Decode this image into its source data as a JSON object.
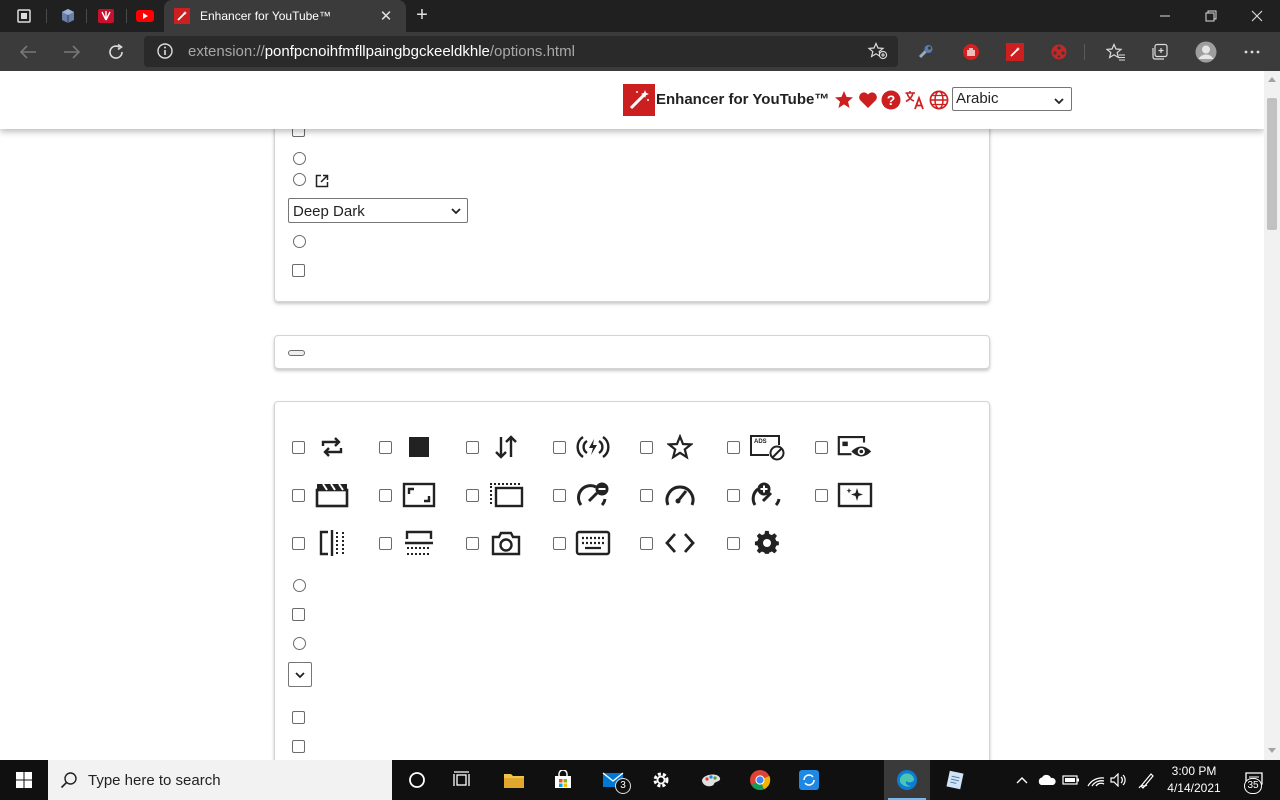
{
  "browser": {
    "active_tab_title": "Enhancer for YouTube™",
    "tab_close": "✕",
    "new_tab": "+",
    "url": {
      "scheme": "extension://",
      "host": "ponfpcnoihfmfllpaingbgckeeldkhle",
      "path": "/options.html"
    },
    "pinned_tabs": [
      "tab-actions-icon",
      "vm-app-icon",
      "huawei-icon",
      "youtube-icon"
    ],
    "toolbar_icons": [
      "star-add-icon",
      "extension-wrench-icon",
      "hand-stop-icon",
      "enhancer-icon",
      "film-reel-icon",
      "favorites-icon",
      "collections-icon",
      "profile-avatar",
      "more-icon"
    ]
  },
  "header": {
    "title": "Enhancer for YouTube™",
    "language_value": "Arabic",
    "icons": [
      "rate-star-icon",
      "donate-heart-icon",
      "help-icon",
      "translate-icon",
      "language-globe-icon"
    ],
    "accent": "#cc1f1f"
  },
  "theme_select": {
    "value": "Deep Dark"
  },
  "controls_buttons": {
    "rows": [
      [
        "loop-icon",
        "stop-icon",
        "sort-icon",
        "live-icon",
        "star-icon",
        "ads-block-icon",
        "visibility-icon"
      ],
      [
        "cinema-mode-icon",
        "expand-icon",
        "size-icon",
        "speed-reset-icon",
        "speed-icon",
        "speed-plus-icon",
        "filters-icon"
      ],
      [
        "split-vertical-icon",
        "split-horizontal-icon",
        "screenshot-icon",
        "keyboard-icon",
        "code-icon",
        "settings-icon"
      ]
    ]
  },
  "taskbar": {
    "search_placeholder": "Type here to search",
    "mail_badge": "3",
    "time": "3:00 PM",
    "date": "4/14/2021",
    "notification_count": "35"
  }
}
